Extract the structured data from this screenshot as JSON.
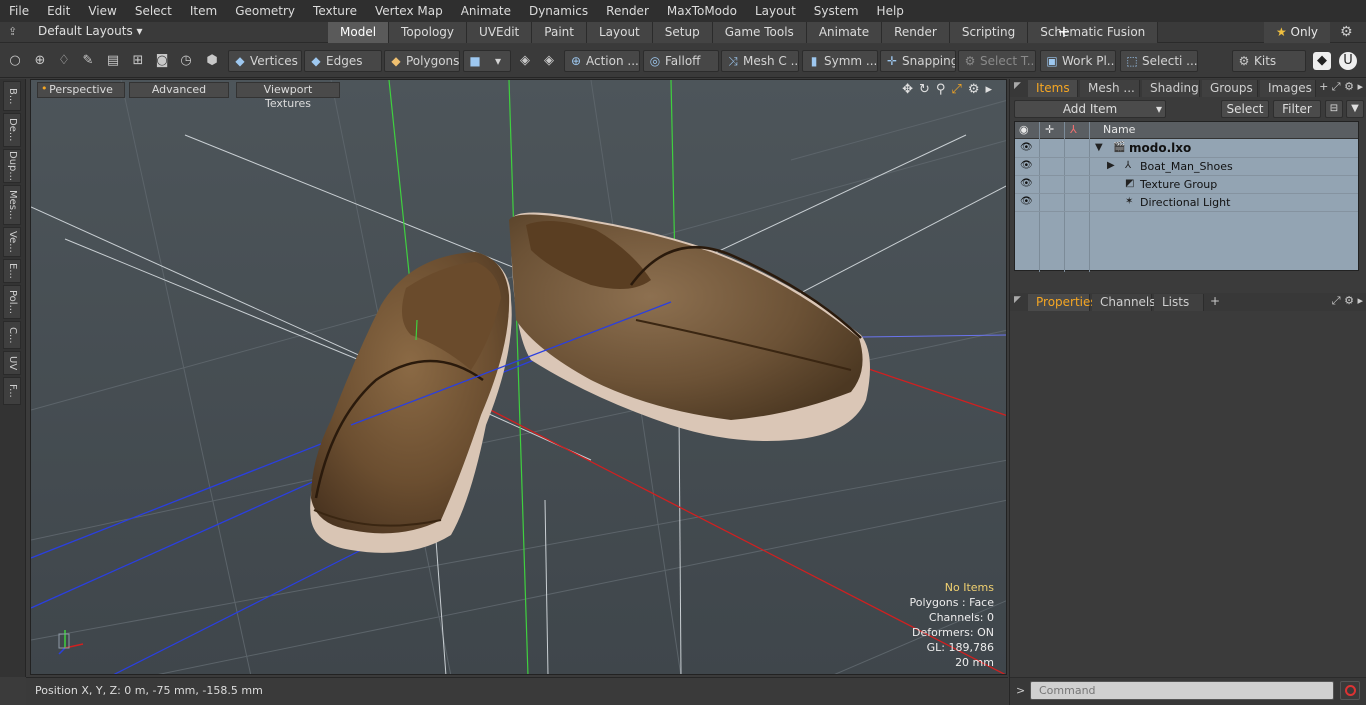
{
  "menu": [
    "File",
    "Edit",
    "View",
    "Select",
    "Item",
    "Geometry",
    "Texture",
    "Vertex Map",
    "Animate",
    "Dynamics",
    "Render",
    "MaxToModo",
    "Layout",
    "System",
    "Help"
  ],
  "layoutbar": {
    "layouts_label": "Default Layouts ▾",
    "tabs": [
      "Model",
      "Topology",
      "UVEdit",
      "Paint",
      "Layout",
      "Setup",
      "Game Tools",
      "Animate",
      "Render",
      "Scripting",
      "Schematic Fusion"
    ],
    "active_tab": "Model",
    "only_label": "Only"
  },
  "toolbar": {
    "vertices": "Vertices",
    "edges": "Edges",
    "polygons": "Polygons",
    "action": "Action ...",
    "falloff": "Falloff",
    "mesh_c": "Mesh C ...",
    "symm": "Symm ...",
    "snapping": "Snapping",
    "select_t": "Select T...",
    "work_pl": "Work Pl...",
    "selecti": "Selecti ...",
    "kits": "Kits"
  },
  "left_tabs": [
    "B...",
    "De...",
    "Dup...",
    "Mes...",
    "Ve...",
    "E...",
    "Pol...",
    "C...",
    "UV",
    "F..."
  ],
  "viewport": {
    "perspective": "Perspective",
    "advanced": "Advanced",
    "viewport_textures": "Viewport Textures",
    "stats": {
      "no_items": "No Items",
      "polygons": "Polygons : Face",
      "channels": "Channels: 0",
      "deformers": "Deformers: ON",
      "gl": "GL: 189,786",
      "scale": "20 mm"
    }
  },
  "status": {
    "position": "Position X, Y, Z:   0 m, -75 mm, -158.5 mm"
  },
  "items_panel": {
    "tabs": [
      "Items",
      "Mesh ...",
      "Shading",
      "Groups",
      "Images"
    ],
    "active_tab": "Items",
    "add_item": "Add Item",
    "select": "Select",
    "filter": "Filter",
    "name_col": "Name",
    "rows": [
      {
        "label": "modo.lxo"
      },
      {
        "label": "Boat_Man_Shoes"
      },
      {
        "label": "Texture Group"
      },
      {
        "label": "Directional Light"
      }
    ]
  },
  "props_panel": {
    "tabs": [
      "Properties",
      "Channels",
      "Lists"
    ],
    "active_tab": "Properties"
  },
  "command": {
    "placeholder": "Command"
  },
  "colors": {
    "accent": "#f5a623",
    "viewport_bg": "#4a5156",
    "tree_bg": "#93a4b3"
  }
}
